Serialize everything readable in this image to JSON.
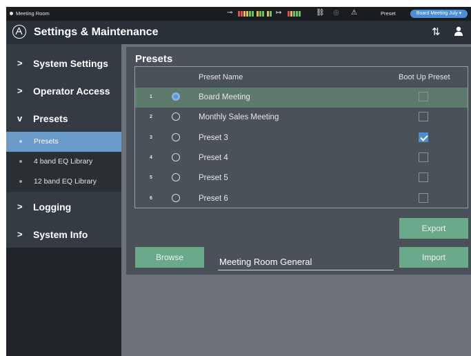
{
  "status": {
    "room": "Meeting Room",
    "preset_label": "Preset",
    "preset_value": "Board Meeting July",
    "icons": [
      "input-meter-icon",
      "output-meter-icon",
      "link-icon",
      "wireless-icon",
      "warning-icon",
      "dropdown-arrow-icon"
    ]
  },
  "header": {
    "title": "Settings & Maintenance",
    "icons": [
      "audio-technica-logo",
      "mixer-settings-icon",
      "user-icon"
    ]
  },
  "sidebar": {
    "items": [
      {
        "label": "System Settings",
        "chevron": ">"
      },
      {
        "label": "Operator Access",
        "chevron": ">"
      },
      {
        "label": "Presets",
        "chevron": "v"
      },
      {
        "label": "Logging",
        "chevron": ">"
      },
      {
        "label": "System Info",
        "chevron": ">"
      }
    ],
    "subitems": [
      {
        "label": "Presets",
        "active": true
      },
      {
        "label": "4 band EQ Library",
        "active": false
      },
      {
        "label": "12 band EQ Library",
        "active": false
      }
    ]
  },
  "presets": {
    "title": "Presets",
    "columns": {
      "name": "Preset Name",
      "boot": "Boot Up Preset"
    },
    "rows": [
      {
        "num": "1",
        "name": "Board Meeting",
        "selected": true,
        "boot": false
      },
      {
        "num": "2",
        "name": "Monthly Sales Meeting",
        "selected": false,
        "boot": false
      },
      {
        "num": "3",
        "name": "Preset 3",
        "selected": false,
        "boot": true
      },
      {
        "num": "4",
        "name": "Preset 4",
        "selected": false,
        "boot": false
      },
      {
        "num": "5",
        "name": "Preset 5",
        "selected": false,
        "boot": false
      },
      {
        "num": "6",
        "name": "Preset 6",
        "selected": false,
        "boot": false
      }
    ],
    "export_label": "Export",
    "browse_label": "Browse",
    "file_name": "Meeting Room General",
    "import_label": "Import"
  },
  "colors": {
    "accent_blue": "#4a8fd6",
    "button_green": "#6aa98a",
    "selected_row": "#5e7a6c",
    "active_nav": "#6a9bc9"
  }
}
